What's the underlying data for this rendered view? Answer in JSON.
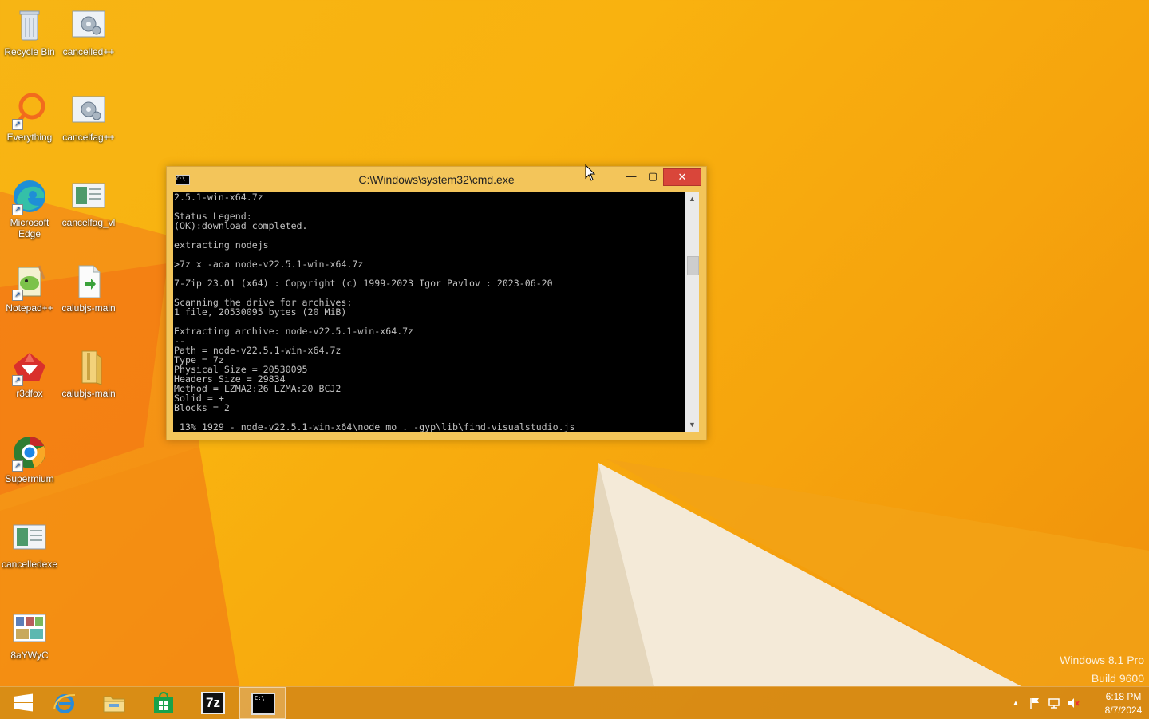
{
  "desktop": {
    "icons": [
      {
        "label": "Recycle Bin"
      },
      {
        "label": "cancelled++"
      },
      {
        "label": "Everything"
      },
      {
        "label": "cancelfag++"
      },
      {
        "label": "Microsoft Edge"
      },
      {
        "label": "cancelfag_vl"
      },
      {
        "label": "Notepad++"
      },
      {
        "label": "calubjs-main"
      },
      {
        "label": "r3dfox"
      },
      {
        "label": "calubjs-main"
      },
      {
        "label": "Supermium"
      },
      {
        "label": "cancelledexe"
      },
      {
        "label": "8aYWyC"
      }
    ],
    "watermark": {
      "line1": "Windows 8.1 Pro",
      "line2": "Build 9600"
    }
  },
  "cmd": {
    "title": "C:\\Windows\\system32\\cmd.exe",
    "icon_text": "C:\\.",
    "controls": {
      "minimize": "—",
      "maximize": "▢",
      "close": "✕"
    },
    "lines": [
      "2.5.1-win-x64.7z",
      "",
      "Status Legend:",
      "(OK):download completed.",
      "",
      "extracting nodejs",
      "",
      ">7z x -aoa node-v22.5.1-win-x64.7z",
      "",
      "7-Zip 23.01 (x64) : Copyright (c) 1999-2023 Igor Pavlov : 2023-06-20",
      "",
      "Scanning the drive for archives:",
      "1 file, 20530095 bytes (20 MiB)",
      "",
      "Extracting archive: node-v22.5.1-win-x64.7z",
      "--",
      "Path = node-v22.5.1-win-x64.7z",
      "Type = 7z",
      "Physical Size = 20530095",
      "Headers Size = 29834",
      "Method = LZMA2:26 LZMA:20 BCJ2",
      "Solid = +",
      "Blocks = 2",
      "",
      " 13% 1929 - node-v22.5.1-win-x64\\node_mo . -gyp\\lib\\find-visualstudio.js"
    ],
    "scroll": {
      "up": "▲",
      "down": "▼"
    }
  },
  "taskbar": {
    "sevenzip_label": "7z",
    "cmd_label": "C:\\_",
    "tray": {
      "time": "6:18 PM",
      "date": "8/7/2024",
      "chevron": "▲"
    }
  }
}
